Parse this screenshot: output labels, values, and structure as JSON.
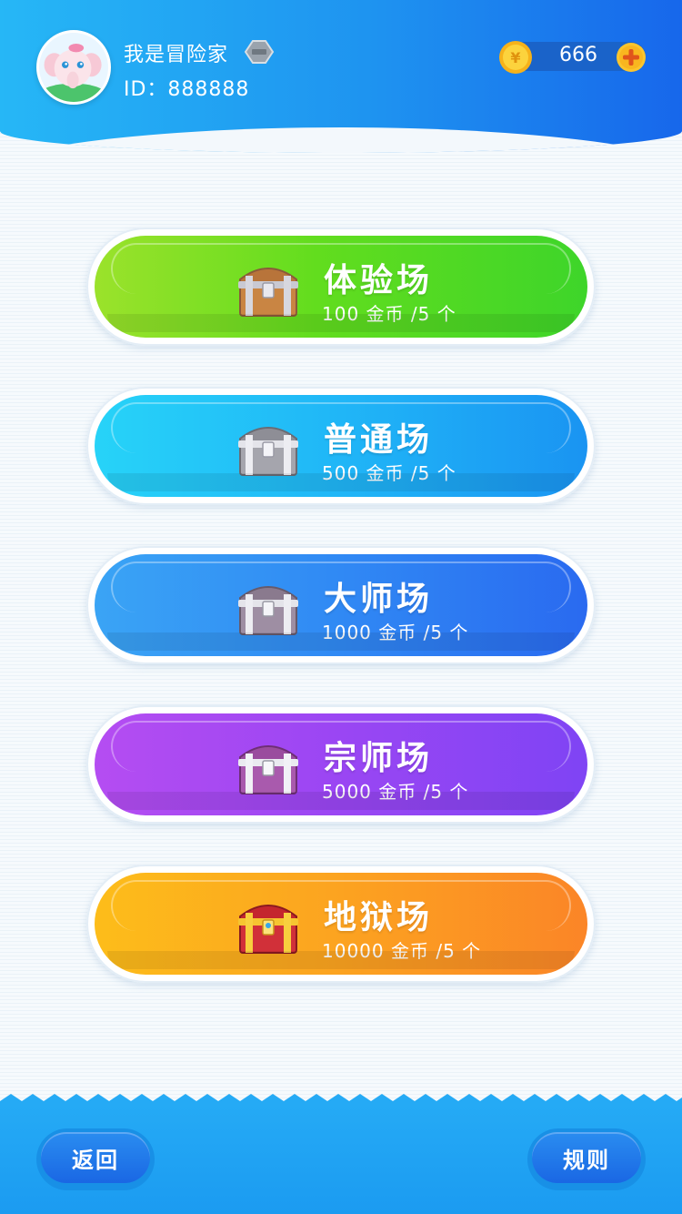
{
  "user": {
    "name": "我是冒险家",
    "id_text": "ID：888888"
  },
  "wallet": {
    "coins": "666"
  },
  "rooms": [
    {
      "title": "体验场",
      "cost": "100 金币 /5 个",
      "chest": "bronze-chest-icon"
    },
    {
      "title": "普通场",
      "cost": "500 金币 /5 个",
      "chest": "silver-chest-icon"
    },
    {
      "title": "大师场",
      "cost": "1000 金币 /5 个",
      "chest": "silver-chest-icon"
    },
    {
      "title": "宗师场",
      "cost": "5000 金币 /5 个",
      "chest": "purple-chest-icon"
    },
    {
      "title": "地狱场",
      "cost": "10000 金币 /5 个",
      "chest": "gold-chest-icon"
    }
  ],
  "footer": {
    "back_label": "返回",
    "rules_label": "规则"
  },
  "colors": {
    "header": "#1e93f0",
    "room_green": "#62dd1e",
    "room_cyan": "#20b6f7",
    "room_blue": "#3089f4",
    "room_purple": "#9a46f3",
    "room_orange": "#fca320"
  }
}
